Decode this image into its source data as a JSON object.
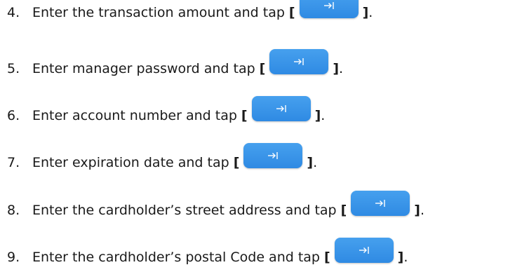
{
  "steps": [
    {
      "number": "4.",
      "text": "Enter the transaction amount and tap",
      "bracket_open": "[",
      "bracket_close": "]",
      "end": ".",
      "button_icon": "tab-arrow-icon"
    },
    {
      "number": "5.",
      "text": "Enter manager password and tap",
      "bracket_open": "[",
      "bracket_close": "]",
      "end": ".",
      "button_icon": "tab-arrow-icon"
    },
    {
      "number": "6.",
      "text": "Enter account number and tap",
      "bracket_open": "[",
      "bracket_close": "]",
      "end": ".",
      "button_icon": "tab-arrow-icon"
    },
    {
      "number": "7.",
      "text": "Enter expiration date and tap",
      "bracket_open": "[",
      "bracket_close": "]",
      "end": ".",
      "button_icon": "tab-arrow-icon"
    },
    {
      "number": "8.",
      "text": "Enter the cardholder’s street address and tap",
      "bracket_open": "[",
      "bracket_close": "]",
      "end": ".",
      "button_icon": "tab-arrow-icon"
    },
    {
      "number": "9.",
      "text": "Enter the cardholder’s postal Code and tap",
      "bracket_open": "[",
      "bracket_close": "]",
      "end": ".",
      "button_icon": "tab-arrow-icon"
    }
  ],
  "colors": {
    "button": "#3a93e8",
    "text": "#1a1a1a"
  }
}
